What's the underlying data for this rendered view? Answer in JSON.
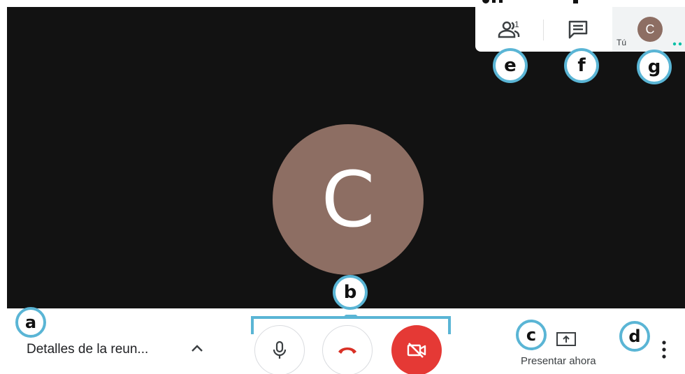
{
  "top_panel": {
    "people_count": "1",
    "self_label": "Tú",
    "self_avatar_letter": "C"
  },
  "main": {
    "avatar_letter": "C"
  },
  "bottom_bar": {
    "meeting_details_label": "Detalles de la reun...",
    "present_label": "Presentar ahora"
  },
  "callouts": {
    "a": "a",
    "b": "b",
    "c": "c",
    "d": "d",
    "e": "e",
    "f": "f",
    "g": "g"
  },
  "icons": {
    "people": "people-icon",
    "chat": "chat-icon",
    "microphone": "microphone-icon",
    "hang_up": "phone-hangup-icon",
    "camera_off": "camera-off-icon",
    "present": "present-screen-icon",
    "more": "more-vert-icon",
    "chevron": "chevron-up-icon"
  },
  "colors": {
    "video_bg": "#121212",
    "avatar": "#8d6e63",
    "camera_off_button": "#e53935",
    "hang_up_icon": "#d93025",
    "callout_border": "#5ab5d5",
    "self_dots": "#00bfa5"
  }
}
